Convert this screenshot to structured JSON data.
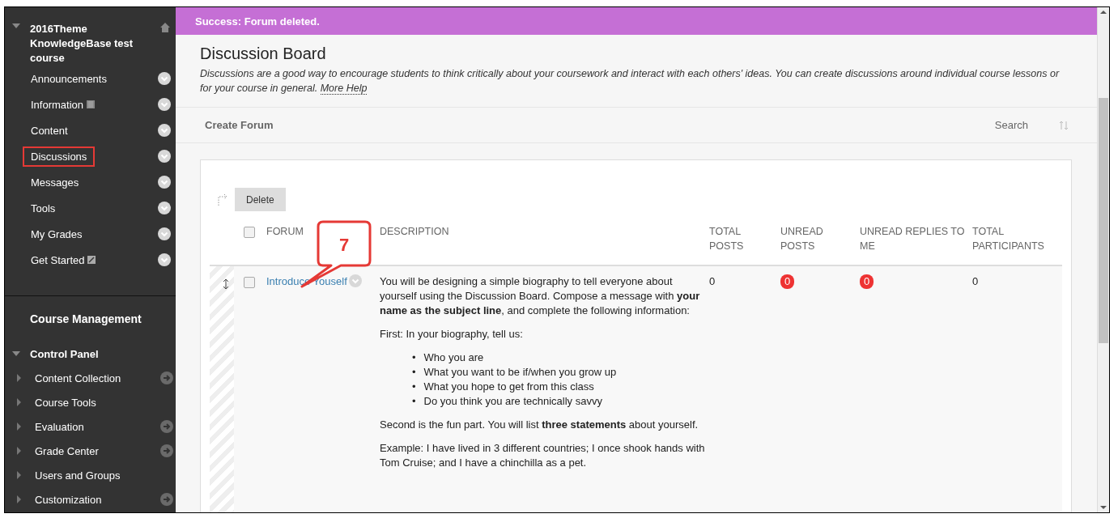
{
  "banner": {
    "message": "Success: Forum deleted."
  },
  "course_menu": {
    "title": "2016Theme KnowledgeBase test course",
    "expanded": true,
    "items": [
      {
        "label": "Announcements",
        "kind": "plain",
        "highlighted": false
      },
      {
        "label": "Information",
        "kind": "grid",
        "highlighted": false
      },
      {
        "label": "Content",
        "kind": "plain",
        "highlighted": false
      },
      {
        "label": "Discussions",
        "kind": "plain",
        "highlighted": true
      },
      {
        "label": "Messages",
        "kind": "plain",
        "highlighted": false
      },
      {
        "label": "Tools",
        "kind": "plain",
        "highlighted": false
      },
      {
        "label": "My Grades",
        "kind": "plain",
        "highlighted": false
      },
      {
        "label": "Get Started",
        "kind": "edit",
        "highlighted": false
      }
    ]
  },
  "course_management": {
    "title": "Course Management",
    "panel": {
      "label": "Control Panel",
      "expanded": true,
      "items": [
        {
          "label": "Content Collection",
          "expanded": false,
          "has_link": true
        },
        {
          "label": "Course Tools",
          "expanded": false,
          "has_link": false
        },
        {
          "label": "Evaluation",
          "expanded": false,
          "has_link": true
        },
        {
          "label": "Grade Center",
          "expanded": false,
          "has_link": true
        },
        {
          "label": "Users and Groups",
          "expanded": false,
          "has_link": false
        },
        {
          "label": "Customization",
          "expanded": false,
          "has_link": true
        }
      ]
    }
  },
  "page": {
    "title": "Discussion Board",
    "description": "Discussions are a good way to encourage students to think critically about your coursework and interact with each others' ideas. You can create discussions around individual course lessons or for your course in general.",
    "help_link": "More Help"
  },
  "action_bar": {
    "create": "Create Forum",
    "search": "Search"
  },
  "table": {
    "delete_button": "Delete",
    "select_all": false,
    "columns": [
      "FORUM",
      "DESCRIPTION",
      "TOTAL POSTS",
      "UNREAD POSTS",
      "UNREAD REPLIES TO ME",
      "TOTAL PARTICIPANTS"
    ],
    "rows": [
      {
        "selected": false,
        "forum": "Introduce Youself",
        "total_posts": "0",
        "unread_posts": "0",
        "unread_replies": "0",
        "total_participants": "0",
        "description": [
          {
            "kind": "paragraph",
            "text": "You will be designing a simple biography to tell everyone about yourself using the Discussion Board.  Compose a message with **your name as the subject line**, and complete the following information:"
          },
          {
            "kind": "paragraph",
            "text": "First: In your biography, tell us:"
          },
          {
            "kind": "list",
            "marker": "•",
            "items": [
              "Who you are",
              "What you want to be if/when you grow up",
              "What you hope to get from this class",
              "Do you think you are technically savvy"
            ]
          },
          {
            "kind": "paragraph",
            "text": "Second is the fun part.  You will list **three statements** about yourself."
          },
          {
            "kind": "paragraph",
            "text": "Example: I have lived in 3 different countries; I once shook hands with Tom Cruise; and I have a chinchilla as a pet."
          }
        ]
      }
    ]
  },
  "callout": {
    "label": "7"
  }
}
